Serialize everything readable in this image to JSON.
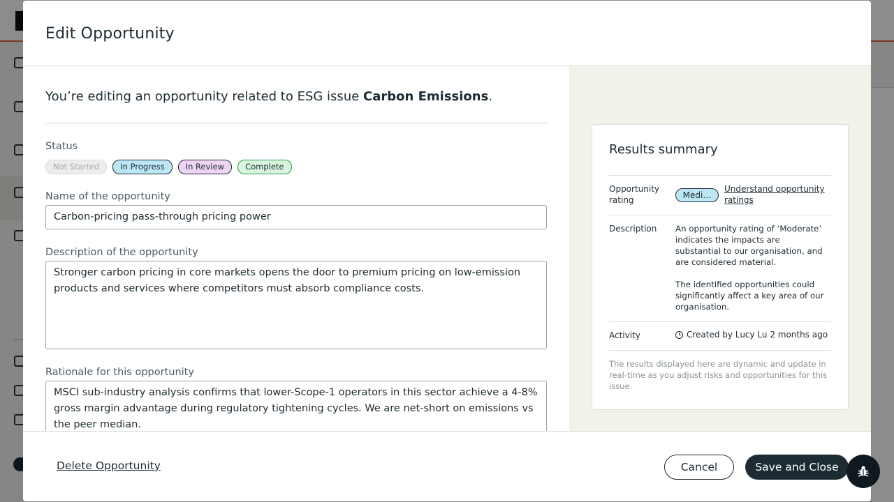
{
  "modal": {
    "title": "Edit Opportunity",
    "intro_prefix": "You’re editing an opportunity related to ESG issue ",
    "intro_issue": "Carbon Emissions",
    "intro_suffix": "."
  },
  "status": {
    "label": "Status",
    "options": [
      "Not Started",
      "In Progress",
      "In Review",
      "Complete"
    ]
  },
  "name_field": {
    "label": "Name of the opportunity",
    "value": "Carbon-pricing pass-through pricing power"
  },
  "description_field": {
    "label": "Description of the opportunity",
    "value": "Stronger carbon pricing in core markets opens the door to premium pricing on low-emission products and services where competitors must absorb compliance costs."
  },
  "rationale_field": {
    "label": "Rationale for this opportunity",
    "value": "MSCI sub-industry analysis confirms that lower-Scope-1 operators in this sector achieve a 4-8% gross margin advantage during regulatory tightening cycles. We are net-short on emissions vs the peer median."
  },
  "summary": {
    "title": "Results summary",
    "rating_label": "Opportunity rating",
    "rating_value": "Medi…",
    "rating_link": "Understand opportunity ratings",
    "description_label": "Description",
    "description_p1": "An opportunity rating of ‘Moderate’ indicates the impacts are substantial to our organisation, and are considered material.",
    "description_p2": "The identified opportunities could significantly affect a key area of our organisation.",
    "activity_label": "Activity",
    "activity_value": "Created by Lucy Lu 2 months ago",
    "note": "The results displayed here are dynamic and update in real-time as you adjust risks and opportunities for this issue."
  },
  "footer": {
    "delete_label": "Delete Opportunity",
    "cancel_label": "Cancel",
    "save_label": "Save and Close"
  },
  "colors": {
    "primary": "#1d2b33",
    "in_progress": "#bde7f5",
    "in_review": "#efd5f3",
    "complete": "#d8f5de",
    "panel_bg": "#f1f2ea",
    "accent_orange": "#e0683d"
  }
}
